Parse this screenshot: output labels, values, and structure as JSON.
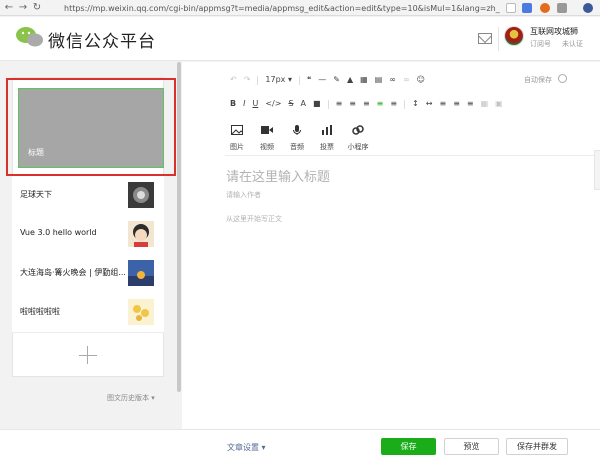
{
  "browser": {
    "url": "https://mp.weixin.qq.com/cgi-bin/appmsg?t=media/appmsg_edit&action=edit&type=10&isMul=1&lang=zh_CN&toke..."
  },
  "header": {
    "app_title": "微信公众平台",
    "account_name": "互联网攻城狮",
    "account_type": "订阅号",
    "account_status": "未认证"
  },
  "articles": {
    "cover_label": "标题",
    "items": [
      {
        "title": "足球天下"
      },
      {
        "title": "Vue 3.0 hello world"
      },
      {
        "title": "大连海岛·篝火晚会 | 伊勤组..."
      },
      {
        "title": "啦啦啦啦啦"
      }
    ],
    "history_label": "图文历史版本 ▾"
  },
  "toolbar": {
    "font_size": "17px ▾",
    "autosave": "自动保存",
    "media": [
      {
        "label": "图片",
        "icon": "image-icon"
      },
      {
        "label": "视频",
        "icon": "video-icon"
      },
      {
        "label": "音频",
        "icon": "audio-icon"
      },
      {
        "label": "投票",
        "icon": "vote-icon"
      },
      {
        "label": "小程序",
        "icon": "miniprogram-icon"
      }
    ]
  },
  "editor": {
    "title_placeholder": "请在这里输入标题",
    "author_placeholder": "请输入作者",
    "body_placeholder": "从这里开始写正文"
  },
  "footer": {
    "settings_label": "文章设置 ▾",
    "save_label": "保存",
    "preview_label": "预览",
    "publish_label": "保存并群发"
  },
  "colors": {
    "primary_green": "#1aad19",
    "highlight_red": "#d9302c",
    "link_blue": "#576b95"
  }
}
